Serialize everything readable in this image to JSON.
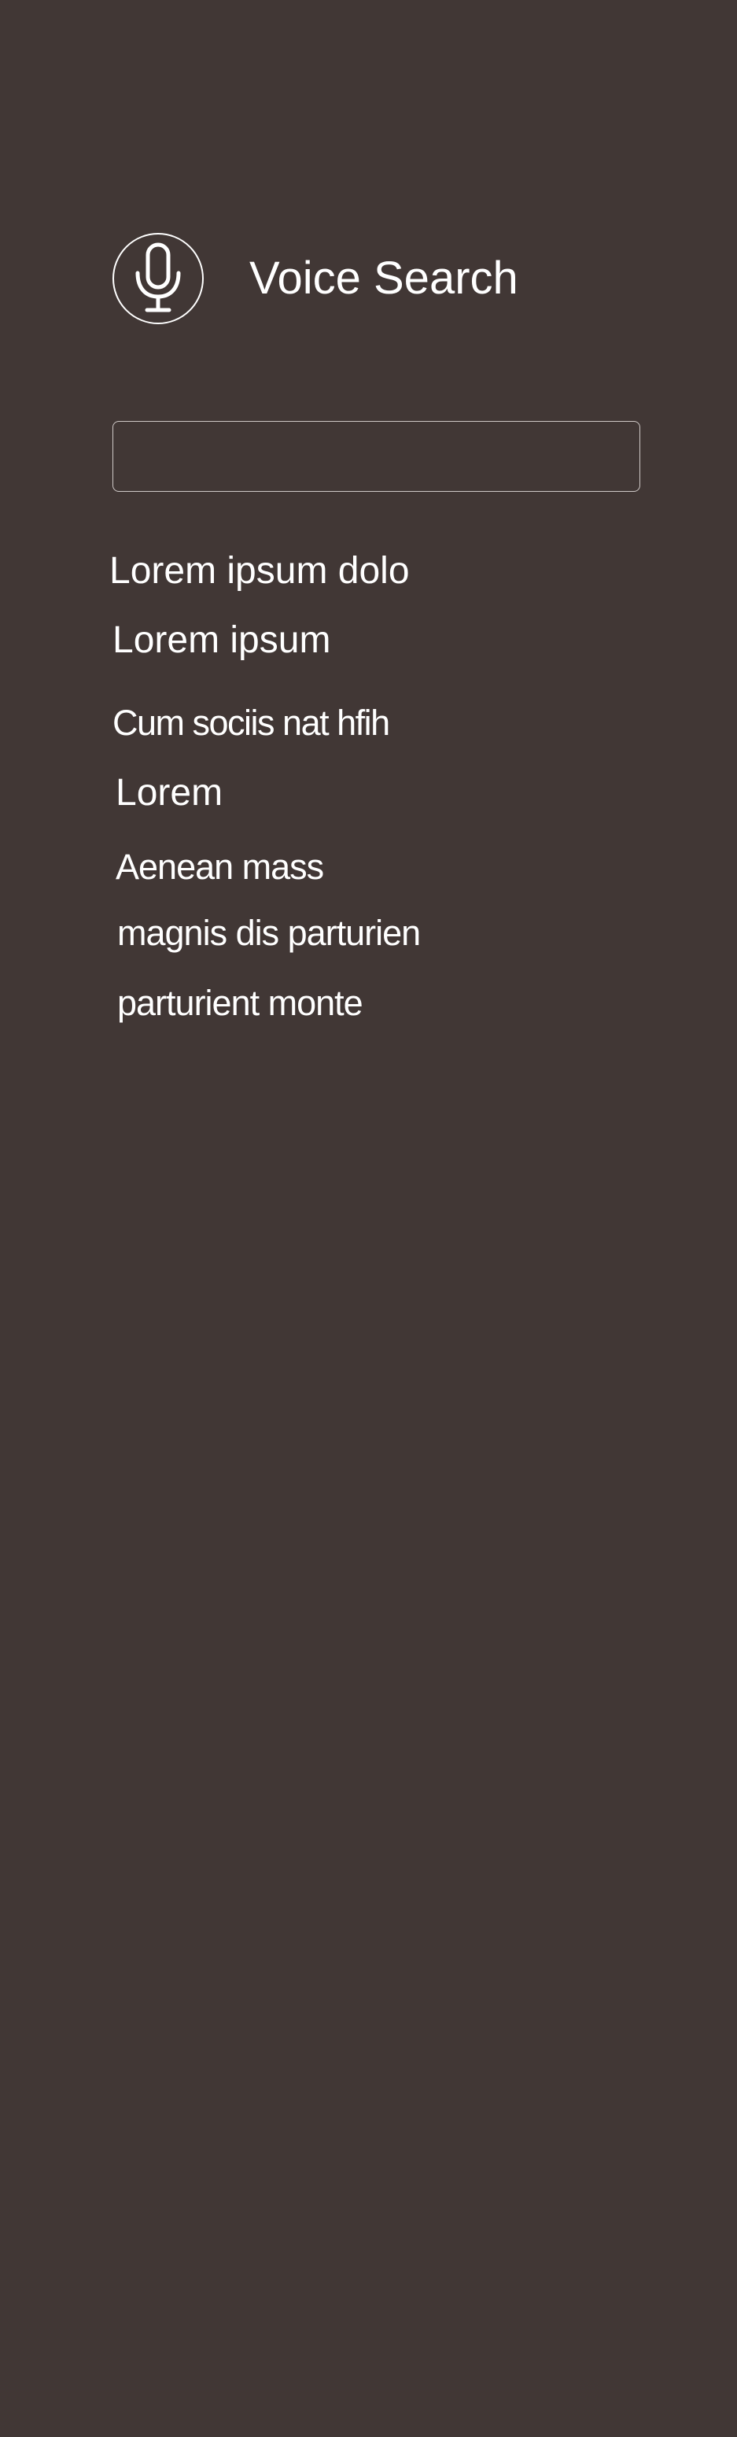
{
  "header": {
    "title": "Voice Search",
    "mic_icon": "microphone-icon"
  },
  "search": {
    "value": "",
    "placeholder": ""
  },
  "results": [
    "Lorem ipsum dolo",
    "Lorem ipsum",
    "Cum sociis nat hfih",
    "Lorem",
    "Aenean mass",
    "magnis dis parturien",
    "parturient monte"
  ],
  "colors": {
    "background": "#413735",
    "foreground": "#ffffff",
    "input_border": "#cfc9c7"
  }
}
